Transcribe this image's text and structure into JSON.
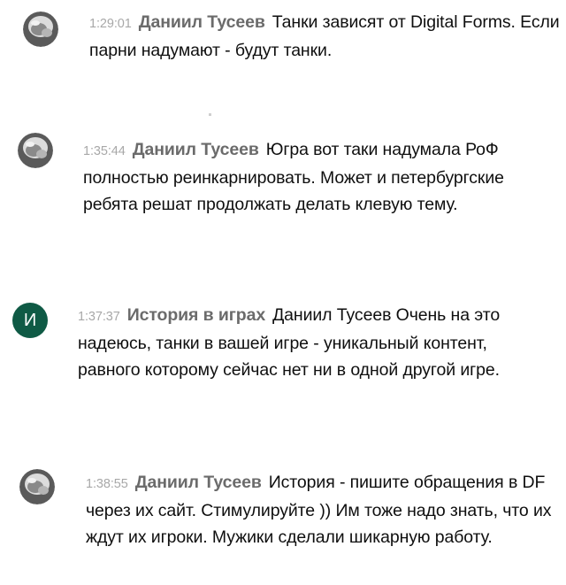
{
  "messages": [
    {
      "time": "1:29:01",
      "author": "Даниил Тусеев",
      "text": "Танки зависят от Digital Forms. Если парни надумают - будут танки."
    },
    {
      "time": "1:35:44",
      "author": "Даниил Тусеев",
      "text": "Югра вот таки надумала РоФ полностью реинкарнировать. Может и петербургские ребята решат продолжать делать клевую тему."
    },
    {
      "time": "1:37:37",
      "author": "История в играх",
      "avatar_letter": "И",
      "text": "Даниил Тусеев Очень на это надеюсь, танки в вашей игре - уникальный контент, равного которому сейчас нет ни в одной другой игре."
    },
    {
      "time": "1:38:55",
      "author": "Даниил Тусеев",
      "text": "История - пишите обращения в DF через их сайт. Стимулируйте )) Им тоже надо знать, что их ждут их игроки. Мужики сделали шикарную работу."
    }
  ],
  "colors": {
    "letter_avatar_bg": "#0f5a45",
    "timestamp": "#a8a8a8",
    "author": "#6b6b6b",
    "message_text": "#0f0f0f"
  },
  "icons": {
    "user_avatar": "helmet-avatar-icon"
  }
}
